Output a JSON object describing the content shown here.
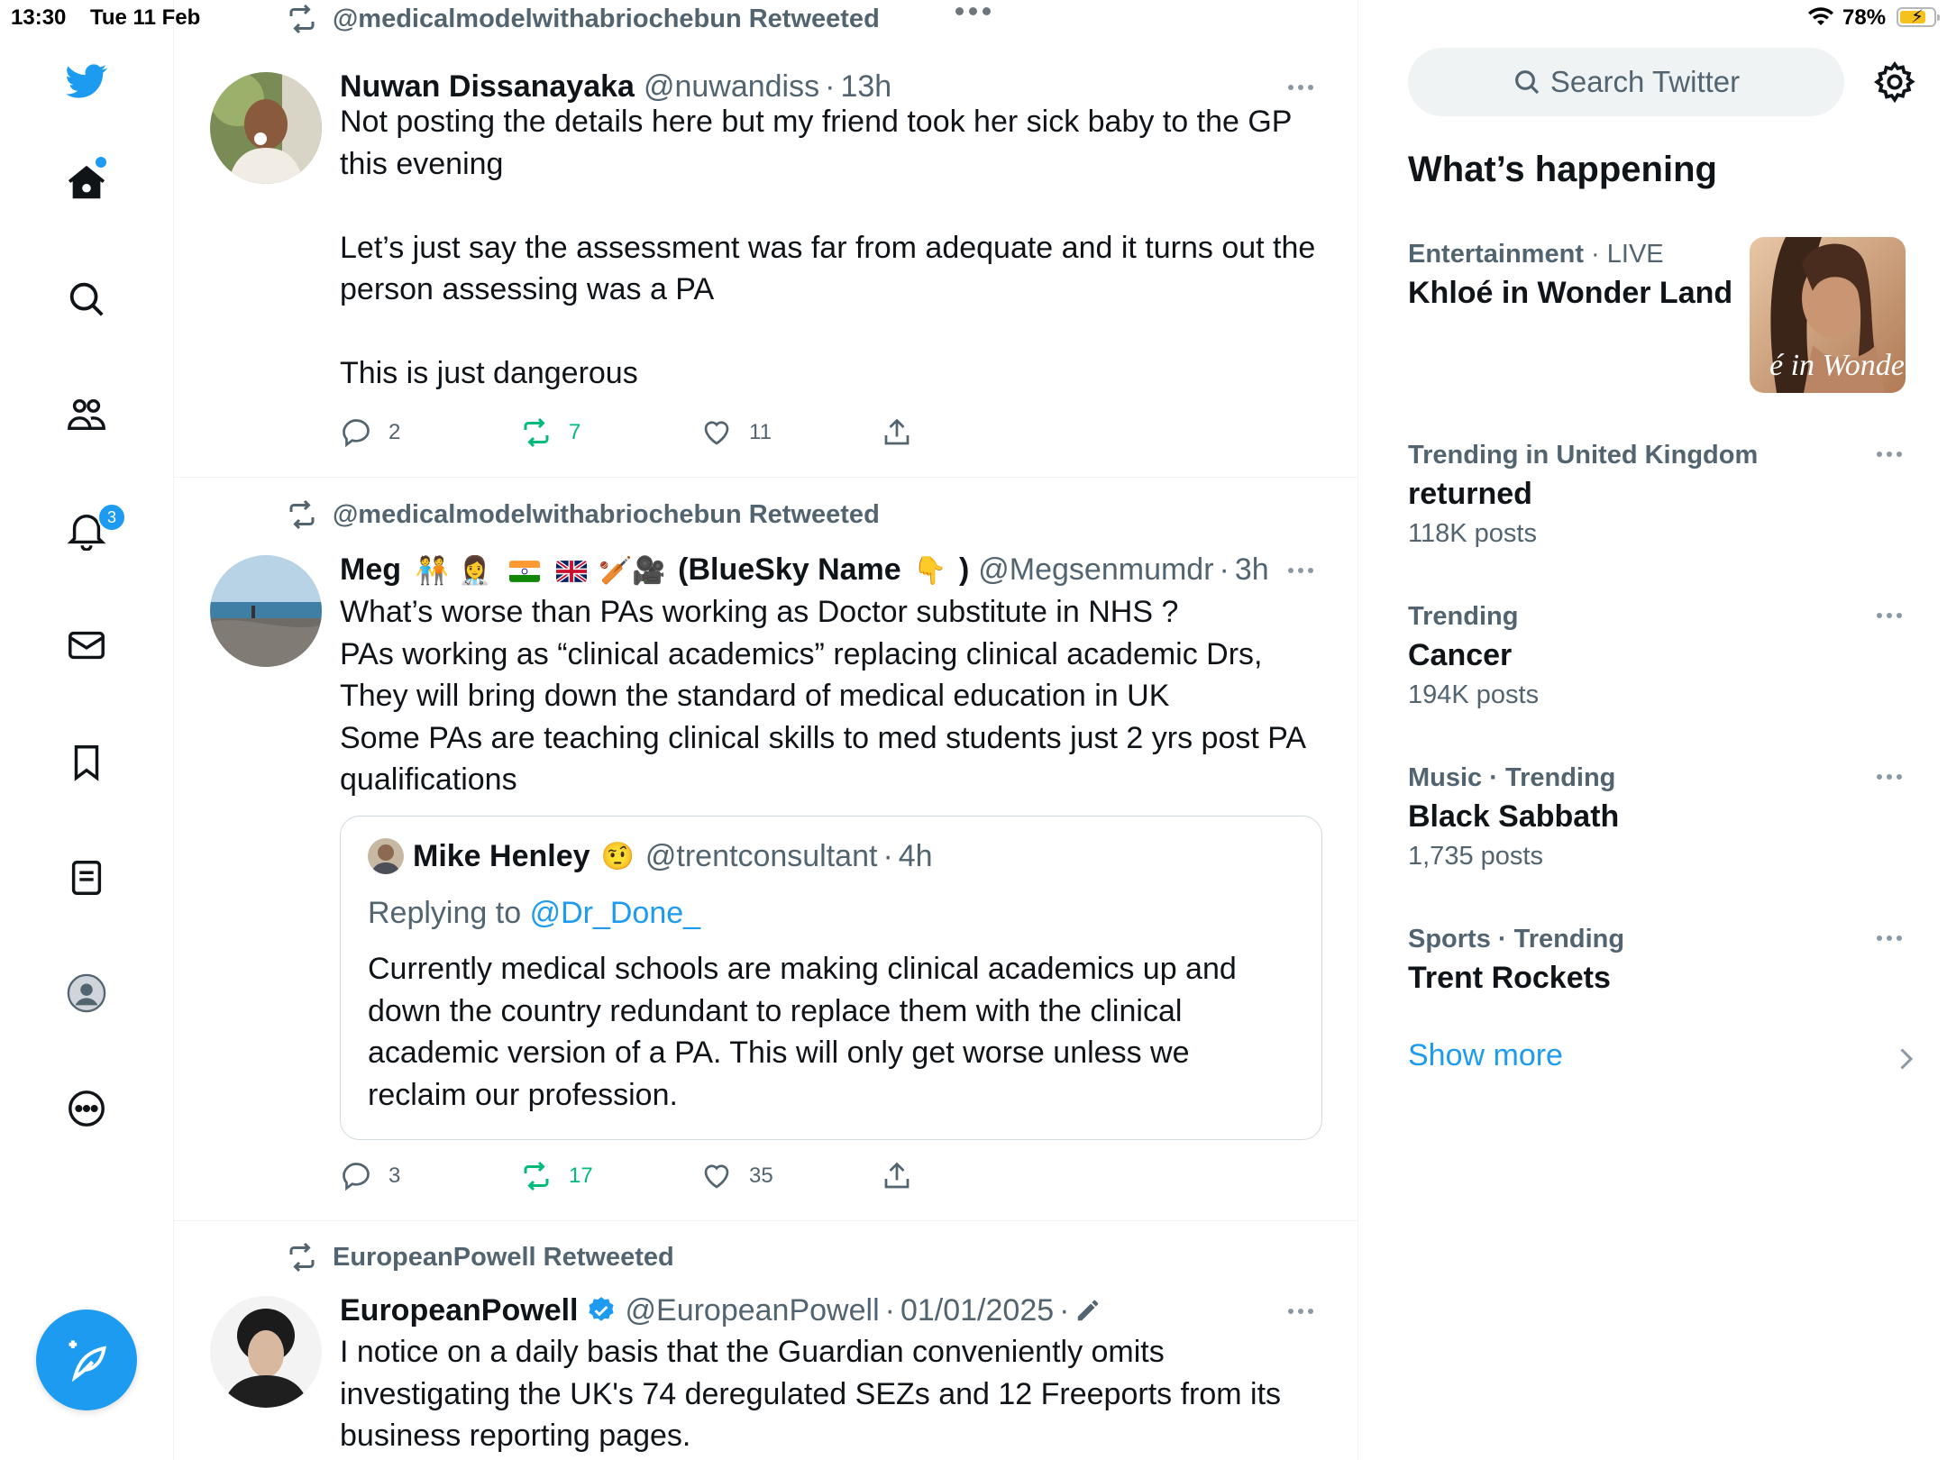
{
  "status_bar": {
    "time": "13:30",
    "date": "Tue 11 Feb",
    "battery": "78%",
    "battery_level": 0.78
  },
  "nav": {
    "notifications_count": "3"
  },
  "tweets": [
    {
      "retweeted_by": "@medicalmodelwithabriochebun Retweeted",
      "name": "Nuwan Dissanayaka",
      "handle": "@nuwandiss",
      "time": "13h",
      "text": "Not posting the details here but my friend took her sick baby to the GP this evening\n\nLet’s just say the assessment was far from adequate and it turns out the person assessing was a PA\n\nThis is just dangerous",
      "replies": "2",
      "retweets": "7",
      "likes": "11"
    },
    {
      "retweeted_by": "@medicalmodelwithabriochebun Retweeted",
      "name_prefix": "Meg",
      "name_suffix": "(BlueSky Name",
      "name_end": ")",
      "handle": "@Megsenmumdr",
      "time": "3h",
      "text": "What’s worse than PAs working as Doctor substitute in NHS ?\nPAs working as “clinical academics” replacing clinical academic Drs,\nThey will bring down the standard of medical education in UK\nSome PAs are teaching clinical skills to med students just 2 yrs post PA qualifications",
      "quote": {
        "name": "Mike Henley",
        "handle": "@trentconsultant",
        "time": "4h",
        "replying_to_label": "Replying to",
        "replying_to": "@Dr_Done_",
        "text": "Currently medical schools are making clinical academics up and down the country redundant to replace them with the clinical academic version of a PA. This will only get worse unless we reclaim our profession."
      },
      "replies": "3",
      "retweets": "17",
      "likes": "35"
    },
    {
      "retweeted_by": "EuropeanPowell Retweeted",
      "name": "EuropeanPowell",
      "handle": "@EuropeanPowell",
      "time": "01/01/2025",
      "text": "I notice on a daily basis that the Guardian conveniently omits investigating the UK's 74 deregulated SEZs and 12 Freeports from its business reporting pages."
    }
  ],
  "sidebar": {
    "search_placeholder": "Search Twitter",
    "whats_happening": "What’s happening",
    "featured": {
      "category": "Entertainment",
      "live": "LIVE",
      "title": "Khloé in Wonder Land",
      "image_text": "é in Wonder l"
    },
    "trends": [
      {
        "context": "Trending in United Kingdom",
        "title": "returned",
        "count": "118K posts"
      },
      {
        "context": "Trending",
        "title": "Cancer",
        "count": "194K posts"
      },
      {
        "context": "Music · Trending",
        "title": "Black Sabbath",
        "count": "1,735 posts"
      },
      {
        "context": "Sports · Trending",
        "title": "Trent Rockets",
        "count": ""
      }
    ],
    "show_more": "Show more"
  },
  "colors": {
    "accent": "#1d9bf0",
    "retweet_green": "#00ba7c",
    "secondary_text": "#536471",
    "border": "#eff3f4"
  }
}
